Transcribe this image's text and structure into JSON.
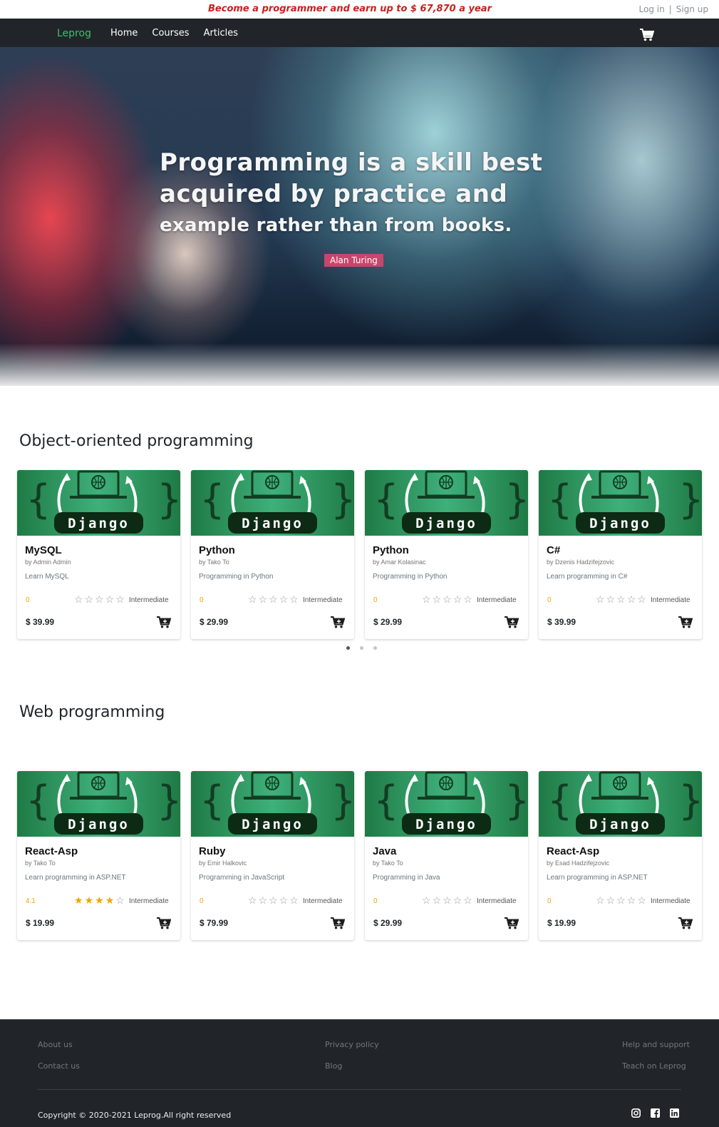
{
  "topbar": {
    "promo": "Become a programmer and earn up to $ 67,870 a year",
    "login": "Log in",
    "separator": "|",
    "signup": "Sign up"
  },
  "navbar": {
    "brand": "Leprog",
    "links": [
      "Home",
      "Courses",
      "Articles"
    ],
    "cart_icon": "cart-icon"
  },
  "hero": {
    "quote_line1": "Programming is a skill best",
    "quote_line2": "acquired by practice and",
    "quote_line3": "example rather than from books.",
    "author": "Alan Turing"
  },
  "sections": [
    {
      "title": "Object-oriented programming",
      "courses": [
        {
          "thumb": "Django",
          "title": "MySQL",
          "author": "by Admin Admin",
          "desc": "Learn MySQL",
          "rating": "0",
          "stars": 0,
          "level": "Intermediate",
          "price": "$ 39.99"
        },
        {
          "thumb": "Django",
          "title": "Python",
          "author": "by Tako To",
          "desc": "Programming in Python",
          "rating": "0",
          "stars": 0,
          "level": "Intermediate",
          "price": "$ 29.99"
        },
        {
          "thumb": "Django",
          "title": "Python",
          "author": "by Amar Kolasinac",
          "desc": "Programming in Python",
          "rating": "0",
          "stars": 0,
          "level": "Intermediate",
          "price": "$ 29.99"
        },
        {
          "thumb": "Django",
          "title": "C#",
          "author": "by Dzenis Hadzifejzovic",
          "desc": "Learn programming in C#",
          "rating": "0",
          "stars": 0,
          "level": "Intermediate",
          "price": "$ 39.99"
        }
      ]
    },
    {
      "title": "Web programming",
      "courses": [
        {
          "thumb": "Django",
          "title": "React-Asp",
          "author": "by Tako To",
          "desc": "Learn programming in ASP.NET",
          "rating": "4.1",
          "stars": 4,
          "level": "Intermediate",
          "price": "$ 19.99"
        },
        {
          "thumb": "Django",
          "title": "Ruby",
          "author": "by Emir Halkovic",
          "desc": "Programming in JavaScript",
          "rating": "0",
          "stars": 0,
          "level": "Intermediate",
          "price": "$ 79.99"
        },
        {
          "thumb": "Django",
          "title": "Java",
          "author": "by Tako To",
          "desc": "Programming in Java",
          "rating": "0",
          "stars": 0,
          "level": "Intermediate",
          "price": "$ 29.99"
        },
        {
          "thumb": "Django",
          "title": "React-Asp",
          "author": "by Esad Hadzifejzovic",
          "desc": "Learn programming in ASP.NET",
          "rating": "0",
          "stars": 0,
          "level": "Intermediate",
          "price": "$ 19.99"
        }
      ]
    }
  ],
  "carousel": {
    "pages": 3,
    "active": 0
  },
  "footer": {
    "col1": [
      "About us",
      "Contact us"
    ],
    "col2": [
      "Privacy policy",
      "Blog"
    ],
    "col3": [
      "Help and support",
      "Teach on Leprog"
    ],
    "copyright": "Copyright © 2020-2021 Leprog.All right reserved",
    "social": [
      "instagram-icon",
      "facebook-icon",
      "linkedin-icon"
    ]
  },
  "colors": {
    "promo": "#c9201d",
    "brand": "#3ac16a",
    "star": "#f0a500",
    "dark": "#212529",
    "author_badge": "#c9456b"
  }
}
